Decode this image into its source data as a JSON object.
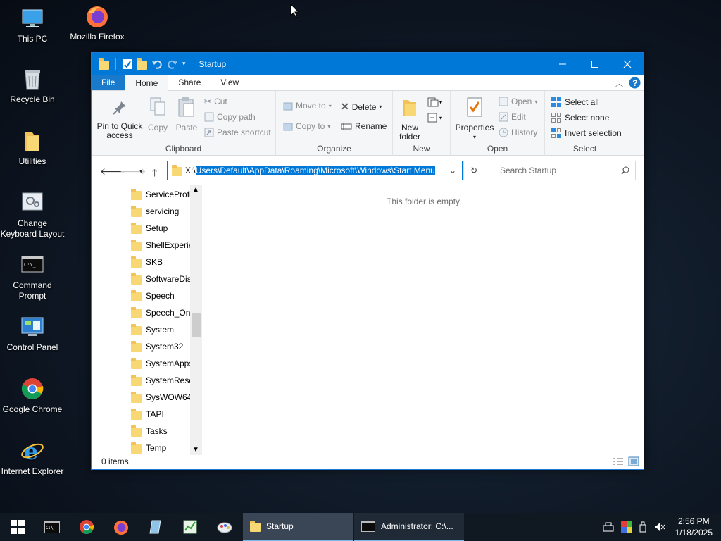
{
  "desktop": {
    "icons": [
      {
        "label": "This PC",
        "icon": "this-pc-icon"
      },
      {
        "label": "Mozilla Firefox",
        "icon": "firefox-icon"
      },
      {
        "label": "Recycle Bin",
        "icon": "recycle-bin-icon"
      },
      {
        "label": "Utilities",
        "icon": "folder-icon"
      },
      {
        "label": "Change Keyboard Layout",
        "icon": "keyboard-settings-icon"
      },
      {
        "label": "Command Prompt",
        "icon": "cmd-icon"
      },
      {
        "label": "Control Panel",
        "icon": "control-panel-icon"
      },
      {
        "label": "Google Chrome",
        "icon": "chrome-icon"
      },
      {
        "label": "Internet Explorer",
        "icon": "ie-icon"
      }
    ]
  },
  "window": {
    "title": "Startup",
    "tabs": {
      "file": "File",
      "home": "Home",
      "share": "Share",
      "view": "View"
    },
    "ribbon": {
      "clipboard": {
        "label": "Clipboard",
        "pin": "Pin to Quick access",
        "copy": "Copy",
        "paste": "Paste",
        "cut": "Cut",
        "copy_path": "Copy path",
        "paste_shortcut": "Paste shortcut"
      },
      "organize": {
        "label": "Organize",
        "move_to": "Move to",
        "copy_to": "Copy to",
        "delete": "Delete",
        "rename": "Rename"
      },
      "new": {
        "label": "New",
        "new_folder": "New folder"
      },
      "open": {
        "label": "Open",
        "properties": "Properties",
        "open": "Open",
        "edit": "Edit",
        "history": "History"
      },
      "select": {
        "label": "Select",
        "select_all": "Select all",
        "select_none": "Select none",
        "invert": "Invert selection"
      }
    },
    "address": {
      "drive": "X:\\",
      "path": "Users\\Default\\AppData\\Roaming\\Microsoft\\Windows\\Start Menu"
    },
    "search_placeholder": "Search Startup",
    "nav_items": [
      "ServiceProfi",
      "servicing",
      "Setup",
      "ShellExperie",
      "SKB",
      "SoftwareDis",
      "Speech",
      "Speech_One",
      "System",
      "System32",
      "SystemApps",
      "SystemReso",
      "SysWOW64",
      "TAPI",
      "Tasks",
      "Temp"
    ],
    "empty_message": "This folder is empty.",
    "status": "0 items"
  },
  "taskbar": {
    "startup_label": "Startup",
    "cmd_label": "Administrator: C:\\...",
    "time": "2:56 PM",
    "date": "1/18/2025"
  },
  "colors": {
    "accent": "#0078d7",
    "file_tab": "#1979ca",
    "taskbar": "#101821",
    "folder": "#f8d775"
  }
}
